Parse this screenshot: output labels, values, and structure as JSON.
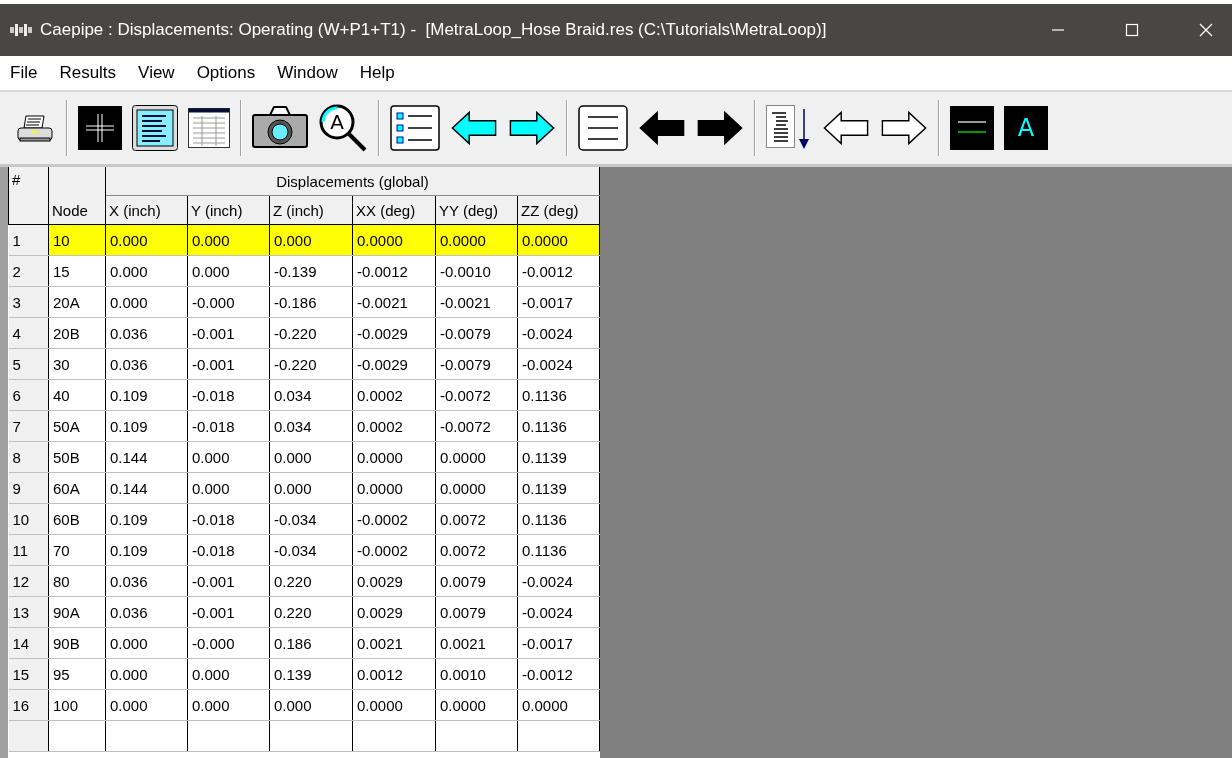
{
  "window": {
    "title": "Caepipe : Displacements: Operating (W+P1+T1) -  [MetraLoop_Hose Braid.res (C:\\Tutorials\\MetraLoop)]"
  },
  "menu": [
    "File",
    "Results",
    "View",
    "Options",
    "Window",
    "Help"
  ],
  "toolbar": [
    {
      "kind": "printer"
    },
    {
      "kind": "sep"
    },
    {
      "kind": "grid"
    },
    {
      "kind": "page"
    },
    {
      "kind": "table"
    },
    {
      "kind": "sep"
    },
    {
      "kind": "camera"
    },
    {
      "kind": "magnifier",
      "label": "A"
    },
    {
      "kind": "sep"
    },
    {
      "kind": "list"
    },
    {
      "kind": "cyan-left"
    },
    {
      "kind": "cyan-right"
    },
    {
      "kind": "sep"
    },
    {
      "kind": "lines"
    },
    {
      "kind": "black-left"
    },
    {
      "kind": "black-right"
    },
    {
      "kind": "sep"
    },
    {
      "kind": "sort"
    },
    {
      "kind": "outline-left"
    },
    {
      "kind": "outline-right"
    },
    {
      "kind": "sep"
    },
    {
      "kind": "line-box"
    },
    {
      "kind": "letter-box",
      "label": "A"
    }
  ],
  "table": {
    "index_header": "#",
    "group_header": "Displacements (global)",
    "columns": [
      "Node",
      "X (inch)",
      "Y (inch)",
      "Z (inch)",
      "XX (deg)",
      "YY (deg)",
      "ZZ (deg)"
    ],
    "rows": [
      {
        "index": "1",
        "cells": [
          "10",
          "0.000",
          "0.000",
          "0.000",
          "0.0000",
          "0.0000",
          "0.0000"
        ],
        "selected": true
      },
      {
        "index": "2",
        "cells": [
          "15",
          "0.000",
          "0.000",
          "-0.139",
          "-0.0012",
          "-0.0010",
          "-0.0012"
        ],
        "selected": false
      },
      {
        "index": "3",
        "cells": [
          "20A",
          "0.000",
          "-0.000",
          "-0.186",
          "-0.0021",
          "-0.0021",
          "-0.0017"
        ],
        "selected": false
      },
      {
        "index": "4",
        "cells": [
          "20B",
          "0.036",
          "-0.001",
          "-0.220",
          "-0.0029",
          "-0.0079",
          "-0.0024"
        ],
        "selected": false
      },
      {
        "index": "5",
        "cells": [
          "30",
          "0.036",
          "-0.001",
          "-0.220",
          "-0.0029",
          "-0.0079",
          "-0.0024"
        ],
        "selected": false
      },
      {
        "index": "6",
        "cells": [
          "40",
          "0.109",
          "-0.018",
          "0.034",
          "0.0002",
          "-0.0072",
          "0.1136"
        ],
        "selected": false
      },
      {
        "index": "7",
        "cells": [
          "50A",
          "0.109",
          "-0.018",
          "0.034",
          "0.0002",
          "-0.0072",
          "0.1136"
        ],
        "selected": false
      },
      {
        "index": "8",
        "cells": [
          "50B",
          "0.144",
          "0.000",
          "0.000",
          "0.0000",
          "0.0000",
          "0.1139"
        ],
        "selected": false
      },
      {
        "index": "9",
        "cells": [
          "60A",
          "0.144",
          "0.000",
          "0.000",
          "0.0000",
          "0.0000",
          "0.1139"
        ],
        "selected": false
      },
      {
        "index": "10",
        "cells": [
          "60B",
          "0.109",
          "-0.018",
          "-0.034",
          "-0.0002",
          "0.0072",
          "0.1136"
        ],
        "selected": false
      },
      {
        "index": "11",
        "cells": [
          "70",
          "0.109",
          "-0.018",
          "-0.034",
          "-0.0002",
          "0.0072",
          "0.1136"
        ],
        "selected": false
      },
      {
        "index": "12",
        "cells": [
          "80",
          "0.036",
          "-0.001",
          "0.220",
          "0.0029",
          "0.0079",
          "-0.0024"
        ],
        "selected": false
      },
      {
        "index": "13",
        "cells": [
          "90A",
          "0.036",
          "-0.001",
          "0.220",
          "0.0029",
          "0.0079",
          "-0.0024"
        ],
        "selected": false
      },
      {
        "index": "14",
        "cells": [
          "90B",
          "0.000",
          "-0.000",
          "0.186",
          "0.0021",
          "0.0021",
          "-0.0017"
        ],
        "selected": false
      },
      {
        "index": "15",
        "cells": [
          "95",
          "0.000",
          "0.000",
          "0.139",
          "0.0012",
          "0.0010",
          "-0.0012"
        ],
        "selected": false
      },
      {
        "index": "16",
        "cells": [
          "100",
          "0.000",
          "0.000",
          "0.000",
          "0.0000",
          "0.0000",
          "0.0000"
        ],
        "selected": false
      }
    ]
  }
}
